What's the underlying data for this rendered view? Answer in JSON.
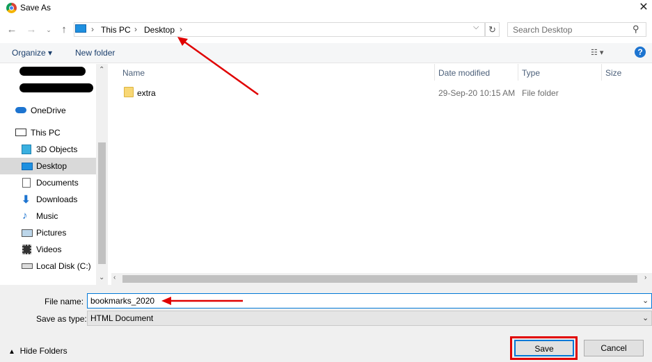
{
  "window": {
    "title": "Save As"
  },
  "address": {
    "crumbs": [
      "This PC",
      "Desktop"
    ],
    "search_placeholder": "Search Desktop"
  },
  "toolbar": {
    "organize_label": "Organize ▾",
    "new_folder_label": "New folder"
  },
  "nav": {
    "items": [
      {
        "label": "OneDrive",
        "icon": "cloud-icon"
      },
      {
        "label": "This PC",
        "icon": "computer-icon"
      },
      {
        "label": "3D Objects",
        "icon": "cube-icon"
      },
      {
        "label": "Desktop",
        "icon": "desktop-icon",
        "selected": true
      },
      {
        "label": "Documents",
        "icon": "document-icon"
      },
      {
        "label": "Downloads",
        "icon": "download-icon"
      },
      {
        "label": "Music",
        "icon": "music-icon"
      },
      {
        "label": "Pictures",
        "icon": "picture-icon"
      },
      {
        "label": "Videos",
        "icon": "video-icon"
      },
      {
        "label": "Local Disk (C:)",
        "icon": "drive-icon"
      }
    ]
  },
  "list": {
    "columns": [
      "Name",
      "Date modified",
      "Type",
      "Size"
    ],
    "rows": [
      {
        "name": "extra",
        "date": "29-Sep-20 10:15 AM",
        "type": "File folder",
        "size": ""
      }
    ]
  },
  "form": {
    "filename_label": "File name:",
    "filename_value": "bookmarks_2020",
    "type_label": "Save as type:",
    "type_value": "HTML Document"
  },
  "buttons": {
    "save": "Save",
    "cancel": "Cancel",
    "hide_folders": "Hide Folders"
  },
  "colors": {
    "accent": "#0078d7",
    "annotation": "#e00000",
    "selection": "#d9d9d9"
  }
}
